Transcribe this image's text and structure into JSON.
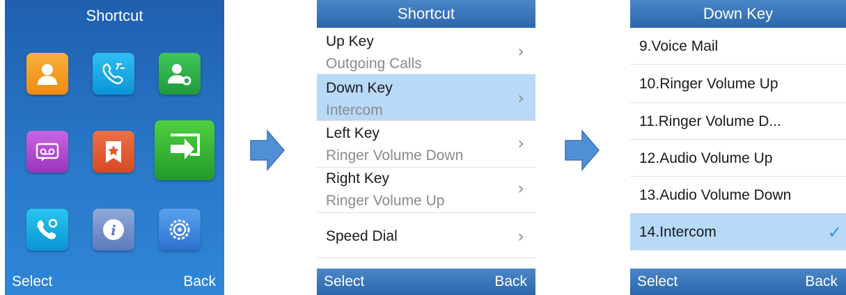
{
  "screen1": {
    "title": "Shortcut",
    "softkeys": {
      "left": "Select",
      "right": "Back"
    },
    "icons": [
      {
        "name": "contacts-icon",
        "color": "#f39c1e"
      },
      {
        "name": "call-history-icon",
        "color": "#16a7e8"
      },
      {
        "name": "account-settings-icon",
        "color": "#2fb24a"
      },
      {
        "name": "voicemail-icon",
        "color": "#b54bd0"
      },
      {
        "name": "favorites-icon",
        "color": "#e25b33"
      },
      {
        "name": "call-forward-icon",
        "color": "#35b53c"
      },
      {
        "name": "call-features-icon",
        "color": "#1ab0e8"
      },
      {
        "name": "status-info-icon",
        "color": "#6f8fc7"
      },
      {
        "name": "settings-icon",
        "color": "#3e87dd"
      }
    ]
  },
  "screen2": {
    "title": "Shortcut",
    "softkeys": {
      "left": "Select",
      "right": "Back"
    },
    "items": [
      {
        "title": "Up Key",
        "value": "Outgoing Calls"
      },
      {
        "title": "Down Key",
        "value": "Intercom"
      },
      {
        "title": "Left Key",
        "value": "Ringer Volume Down"
      },
      {
        "title": "Right Key",
        "value": "Ringer Volume Up"
      },
      {
        "title": "Speed Dial",
        "value": ""
      }
    ]
  },
  "screen3": {
    "title": "Down Key",
    "softkeys": {
      "left": "Select",
      "right": "Back"
    },
    "options": [
      "9.Voice Mail",
      "10.Ringer Volume Up",
      "11.Ringer Volume D...",
      "12.Audio Volume Up",
      "13.Audio Volume Down",
      "14.Intercom"
    ],
    "selected_index": 5
  },
  "colors": {
    "selection": "#b8d9f7",
    "bar": "#2c67ad",
    "arrow": "#4f8fd6"
  }
}
